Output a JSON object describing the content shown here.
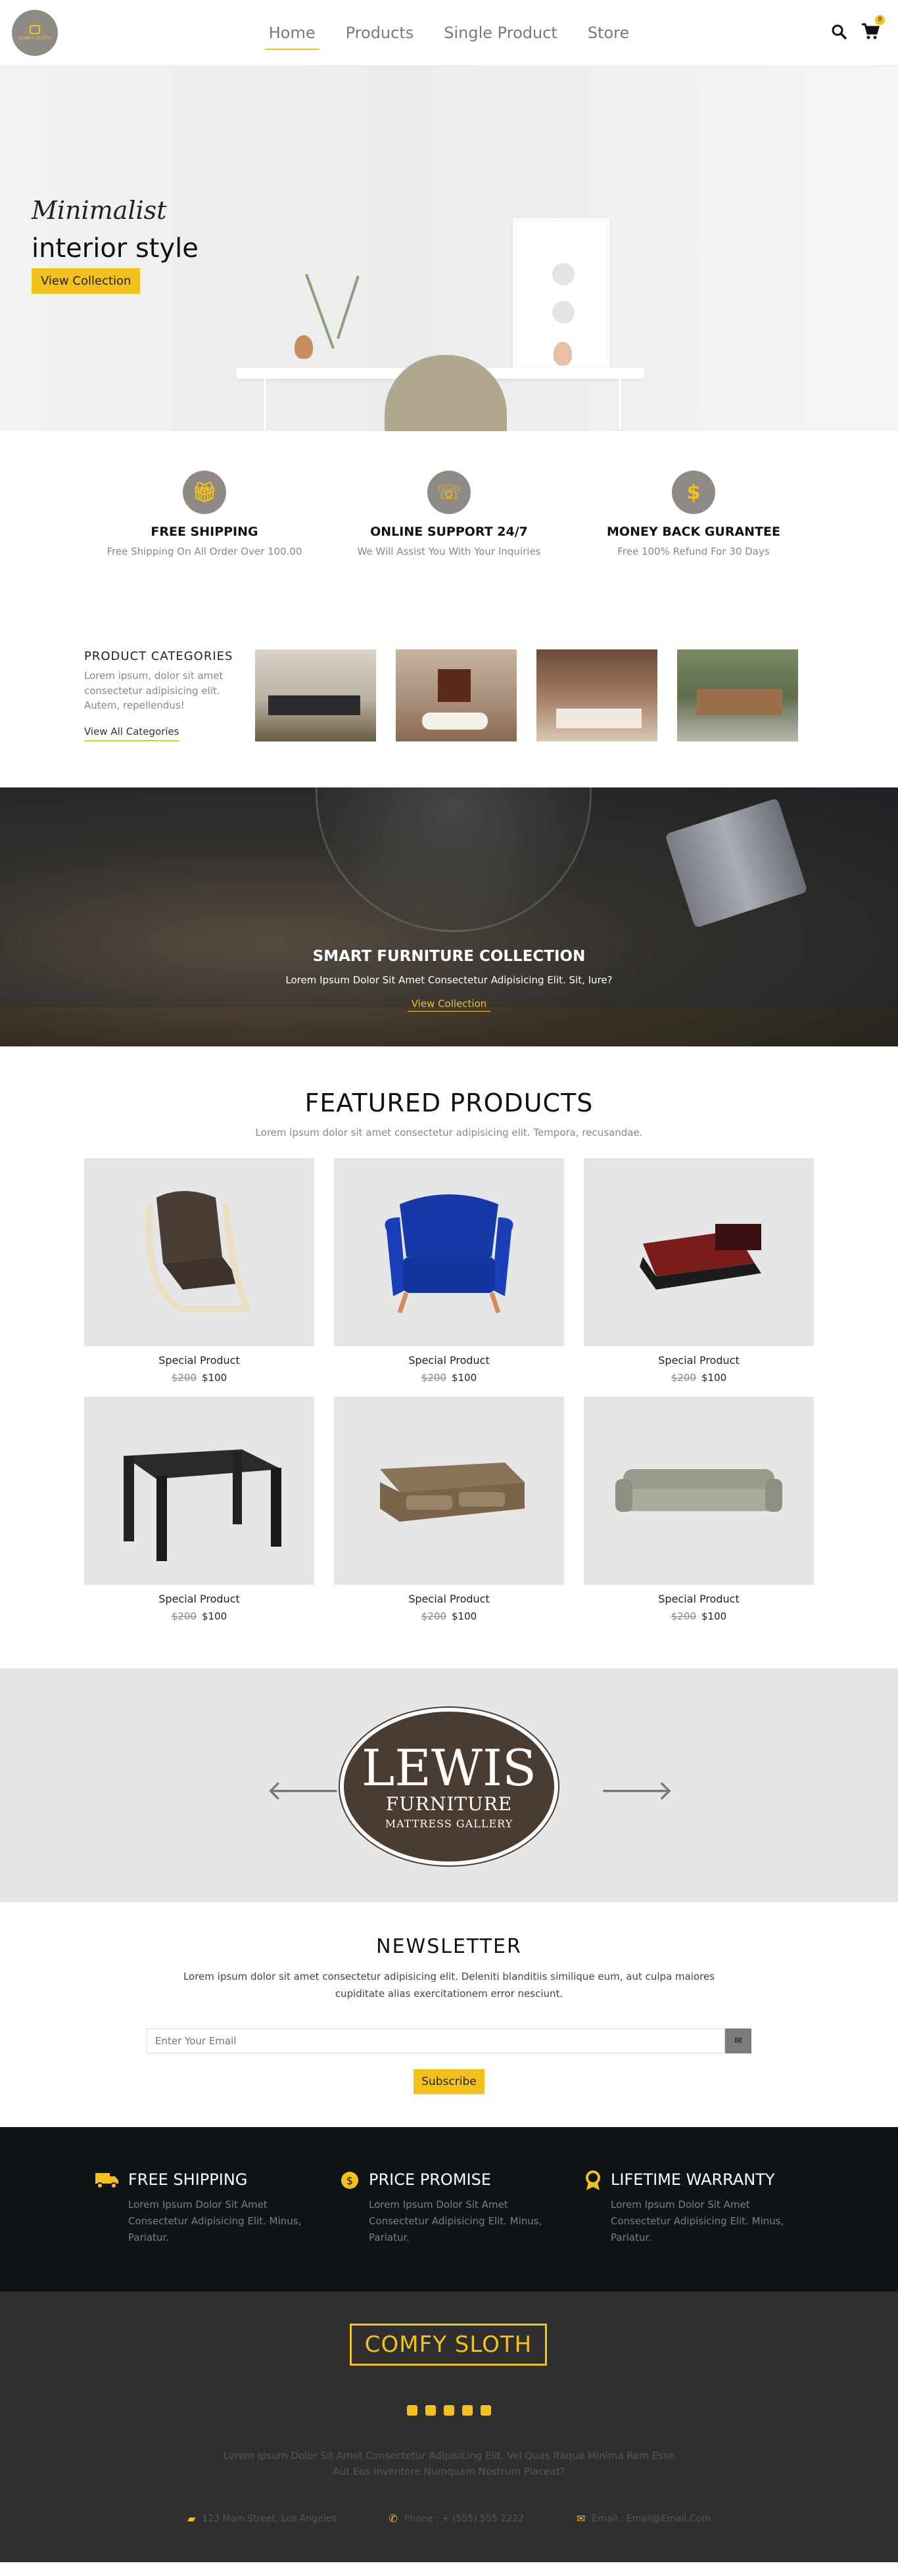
{
  "nav": {
    "logo_text": "COMFY SLOTH",
    "links": [
      "Home",
      "Products",
      "Single Product",
      "Store"
    ],
    "cart_count": "0"
  },
  "hero": {
    "subtitle": "Minimalist",
    "title": "interior style",
    "button": "View Collection"
  },
  "features": [
    {
      "icon": "gift-icon",
      "title": "FREE SHIPPING",
      "text": "Free Shipping On All Order Over 100.00"
    },
    {
      "icon": "phone-icon",
      "title": "ONLINE SUPPORT 24/7",
      "text": "We Will Assist You With Your Inquiries"
    },
    {
      "icon": "dollar-icon",
      "title": "MONEY BACK GURANTEE",
      "text": "Free 100% Refund For 30 Days"
    }
  ],
  "categories": {
    "title": "PRODUCT CATEGORIES",
    "text": "Lorem ipsum, dolor sit amet consectetur adipisicing elit. Autem, repellendus!",
    "link": "View All Categories"
  },
  "banner": {
    "title": "SMART FURNITURE COLLECTION",
    "text": "Lorem Ipsum Dolor Sit Amet Consectetur Adipisicing Elit. Sit, Iure?",
    "link": "View Collection"
  },
  "featured": {
    "title": "FEATURED PRODUCTS",
    "lead": "Lorem ipsum dolor sit amet consectetur adipisicing elit. Tempora, recusandae.",
    "products": [
      {
        "name": "Special Product",
        "old": "$200",
        "price": "$100",
        "img": "armchair"
      },
      {
        "name": "Special Product",
        "old": "$200",
        "price": "$100",
        "img": "blue-armchair"
      },
      {
        "name": "Special Product",
        "old": "$200",
        "price": "$100",
        "img": "bed"
      },
      {
        "name": "Special Product",
        "old": "$200",
        "price": "$100",
        "img": "table"
      },
      {
        "name": "Special Product",
        "old": "$200",
        "price": "$100",
        "img": "sofa-brown"
      },
      {
        "name": "Special Product",
        "old": "$200",
        "price": "$100",
        "img": "sofa-grey"
      }
    ]
  },
  "brand": {
    "line1": "LEWIS",
    "line2": "FURNITURE",
    "line3": "MATTRESS GALLERY",
    "prev": "🡐",
    "next": "🡒"
  },
  "newsletter": {
    "title": "NEWSLETTER",
    "text": "Lorem ipsum dolor sit amet consectetur adipisicing elit. Deleniti blanditiis similique eum, aut culpa maiores cupiditate alias exercitationem error nesciunt.",
    "placeholder": "Enter Your Email",
    "button": "Subscribe"
  },
  "strip": [
    {
      "icon": "truck-icon",
      "title": "FREE SHIPPING",
      "text": "Lorem Ipsum Dolor Sit Amet Consectetur Adipisicing Elit. Minus, Pariatur."
    },
    {
      "icon": "tag-icon",
      "title": "PRICE PROMISE",
      "text": "Lorem Ipsum Dolor Sit Amet Consectetur Adipisicing Elit. Minus, Pariatur."
    },
    {
      "icon": "award-icon",
      "title": "LIFETIME WARRANTY",
      "text": "Lorem Ipsum Dolor Sit Amet Consectetur Adipisicing Elit. Minus, Pariatur."
    }
  ],
  "footer": {
    "logo": "COMFY SLOTH",
    "text": "Lorem Ipsum Dolor Sit Amet Consectetur Adipisicing Elit. Vel Quas Itaque Minima Rem Esse Aut Eos Inventore Numquam Nostrum Placeat?",
    "address": "123 Main Street, Los Angeles",
    "phone": "Phone : + (555) 555 2222",
    "email": "Email : Email@Email.Com"
  },
  "colors": {
    "accent": "#f3c11b",
    "dark": "#0f1418",
    "footer": "#2f2f2f"
  }
}
